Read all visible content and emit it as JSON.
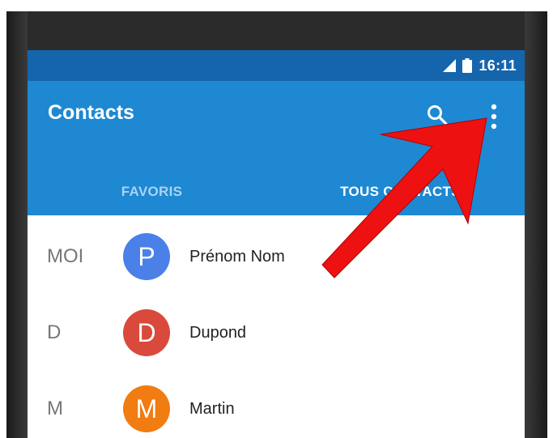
{
  "status_bar": {
    "time": "16:11",
    "icons": [
      "signal-icon",
      "battery-icon"
    ]
  },
  "app_bar": {
    "title": "Contacts",
    "actions": [
      "search-icon",
      "more-vert-icon"
    ]
  },
  "tabs": [
    {
      "label": "FAVORIS",
      "selected": false
    },
    {
      "label": "TOUS CONTACTS",
      "selected": true
    }
  ],
  "contacts": [
    {
      "section": "MOI",
      "initial": "P",
      "name": "Prénom Nom",
      "avatar_color": "#4a80e8"
    },
    {
      "section": "D",
      "initial": "D",
      "name": "Dupond",
      "avatar_color": "#d94a3c"
    },
    {
      "section": "M",
      "initial": "M",
      "name": "Martin",
      "avatar_color": "#f07c12"
    }
  ],
  "colors": {
    "status_bar": "#1565ad",
    "app_bar": "#1e88d2",
    "annotation_arrow": "#ee1111"
  },
  "annotation": {
    "type": "arrow",
    "points_to": "more-vert-icon"
  }
}
